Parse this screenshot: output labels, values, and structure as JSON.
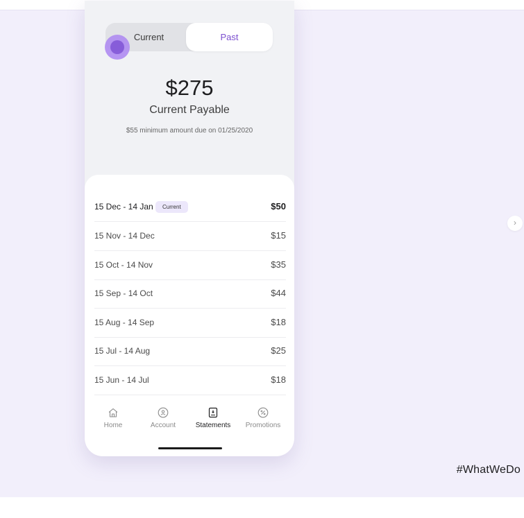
{
  "segmented": {
    "current_label": "Current",
    "past_label": "Past"
  },
  "summary": {
    "amount": "$275",
    "label": "Current Payable",
    "minimum_note": "$55 minimum amount due on 01/25/2020"
  },
  "statements": [
    {
      "period": "15 Dec - 14 Jan",
      "badge": "Current",
      "amount": "$50"
    },
    {
      "period": "15 Nov  - 14 Dec",
      "amount": "$15"
    },
    {
      "period": "15 Oct  - 14 Nov",
      "amount": "$35"
    },
    {
      "period": "15 Sep  - 14 Oct",
      "amount": "$44"
    },
    {
      "period": "15 Aug  - 14 Sep",
      "amount": "$18"
    },
    {
      "period": "15 Jul  - 14 Aug",
      "amount": "$25"
    },
    {
      "period": "15 Jun  - 14 Jul",
      "amount": "$18"
    }
  ],
  "nav": [
    {
      "label": "Home",
      "icon": "home-icon"
    },
    {
      "label": "Account",
      "icon": "account-icon"
    },
    {
      "label": "Statements",
      "icon": "statements-icon",
      "active": true
    },
    {
      "label": "Promotions",
      "icon": "promotions-icon"
    }
  ],
  "hashtag": "#WhatWeDo",
  "colors": {
    "accent": "#7b4fcf",
    "background": "#f2effb",
    "badge": "#ece7fb"
  }
}
